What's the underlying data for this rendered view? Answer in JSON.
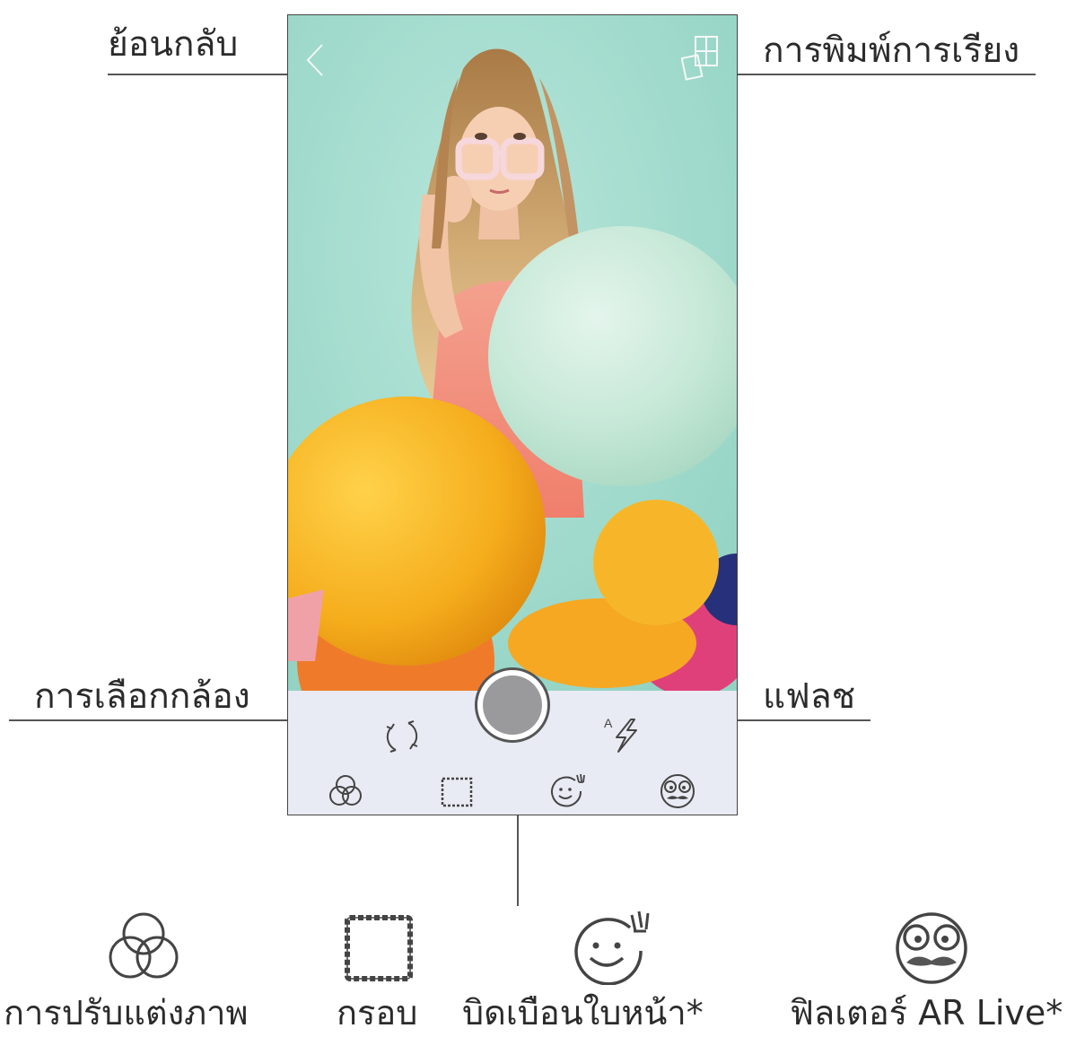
{
  "callouts": {
    "back": "ย้อนกลับ",
    "tile_print": "การพิมพ์การเรียง",
    "camera_select": "การเลือกกล้อง",
    "flash": "แฟลช"
  },
  "icons": {
    "back": "chevron-left-icon",
    "tile_print": "tile-grid-icon",
    "camera_switch": "camera-switch-icon",
    "flash": "auto-flash-icon",
    "shutter": "shutter-button",
    "edit": "overlapping-circles-icon",
    "frame": "dashed-frame-icon",
    "face_warp": "smiley-brush-icon",
    "ar_live": "mustache-face-icon"
  },
  "flash_mode": "A",
  "features": [
    {
      "label": "การปรับแต่งภาพ",
      "icon": "overlapping-circles-icon"
    },
    {
      "label": "กรอบ",
      "icon": "dashed-frame-icon"
    },
    {
      "label": "บิดเบือนใบหน้า*",
      "icon": "smiley-brush-icon"
    },
    {
      "label": "ฟิลเตอร์ AR Live*",
      "icon": "mustache-face-icon"
    }
  ],
  "colors": {
    "photo_background": "#a9e0d3",
    "toolbar": "#e8ebf3",
    "balloon_yellow": "#f5b021",
    "balloon_mint": "#cdebdd",
    "icon_stroke": "#444444"
  }
}
